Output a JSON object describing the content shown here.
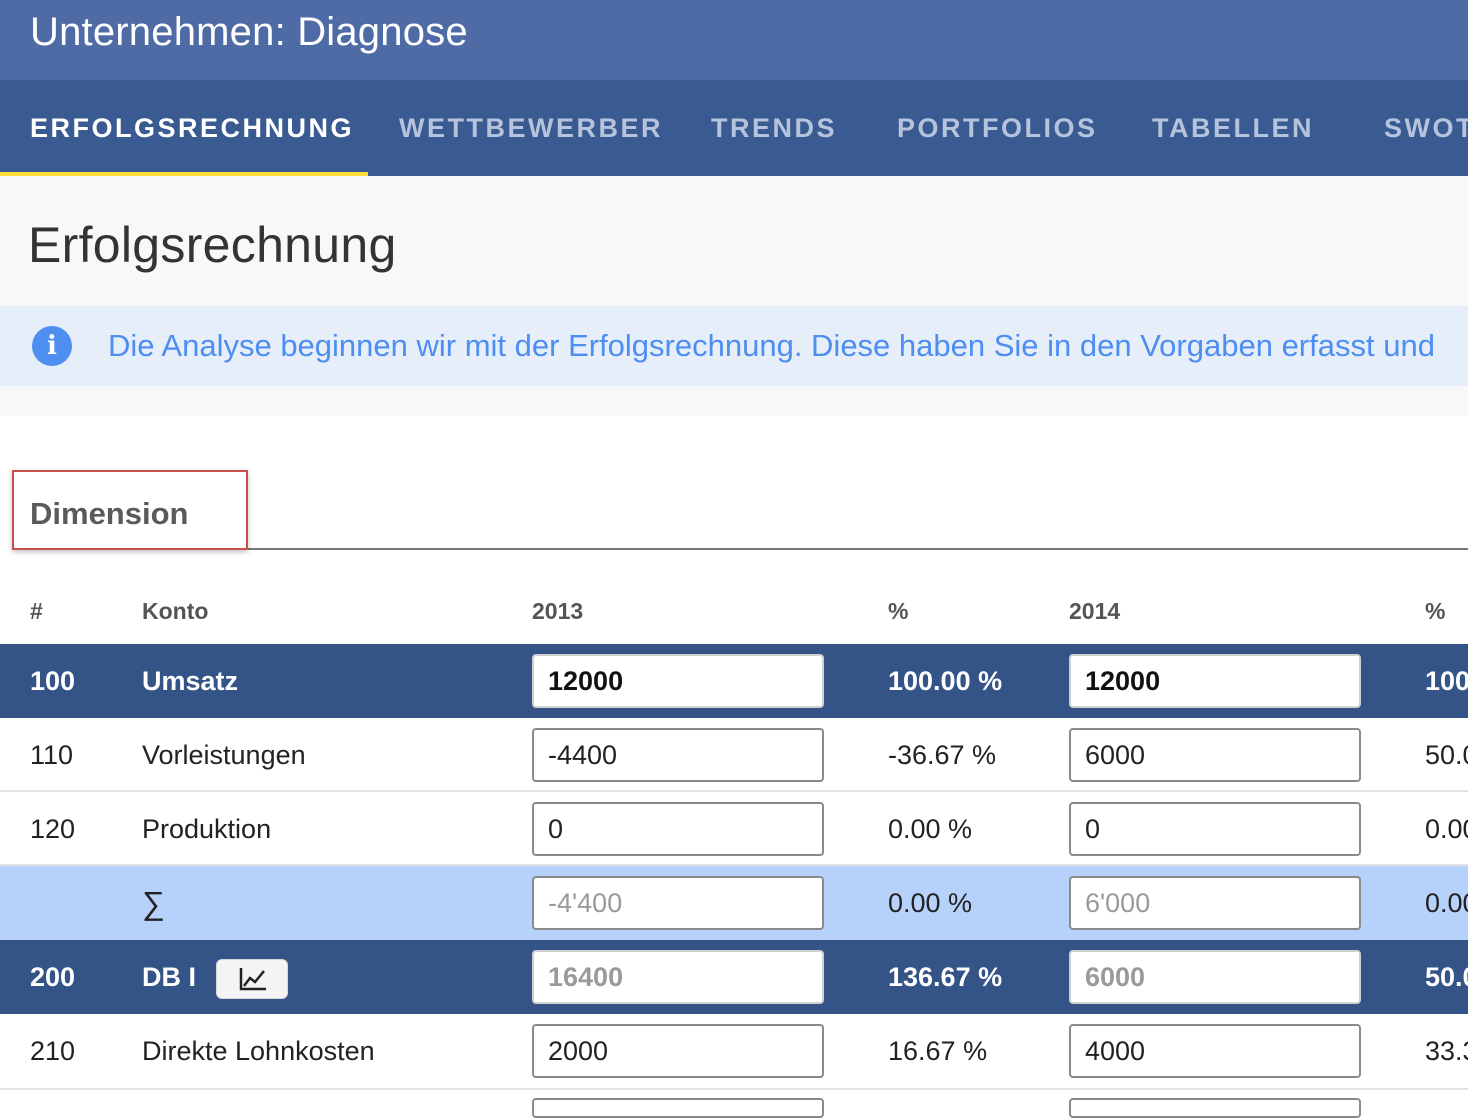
{
  "appbar": {
    "title": "Unternehmen: Diagnose"
  },
  "tabs": [
    {
      "label": "ERFOLGSRECHNUNG",
      "active": true
    },
    {
      "label": "WETTBEWERBER",
      "active": false
    },
    {
      "label": "TRENDS",
      "active": false
    },
    {
      "label": "PORTFOLIOS",
      "active": false
    },
    {
      "label": "TABELLEN",
      "active": false
    },
    {
      "label": "SWOT",
      "active": false
    }
  ],
  "page": {
    "title": "Erfolgsrechnung"
  },
  "banner": {
    "icon": "info-icon",
    "text": "Die Analyse beginnen wir mit der Erfolgsrechnung. Diese haben Sie in den Vorgaben erfasst und"
  },
  "section": {
    "label": "Dimension"
  },
  "table": {
    "headers": {
      "num": "#",
      "konto": "Konto",
      "y2013": "2013",
      "pct2013": "%",
      "y2014": "2014",
      "pct2014": "%"
    },
    "rows": [
      {
        "num": "100",
        "konto": "Umsatz",
        "v2013": "12000",
        "p2013": "100.00 %",
        "v2014": "12000",
        "p2014": "100"
      },
      {
        "num": "110",
        "konto": "Vorleistungen",
        "v2013": "-4400",
        "p2013": "-36.67 %",
        "v2014": "6000",
        "p2014": "50.0"
      },
      {
        "num": "120",
        "konto": "Produktion",
        "v2013": "0",
        "p2013": "0.00 %",
        "v2014": "0",
        "p2014": "0.00"
      },
      {
        "num": "",
        "konto": "∑",
        "v2013": "-4'400",
        "p2013": "0.00 %",
        "v2014": "6'000",
        "p2014": "0.00"
      },
      {
        "num": "200",
        "konto": "DB I",
        "v2013": "16400",
        "p2013": "136.67 %",
        "v2014": "6000",
        "p2014": "50.0"
      },
      {
        "num": "210",
        "konto": "Direkte Lohnkosten",
        "v2013": "2000",
        "p2013": "16.67 %",
        "v2014": "4000",
        "p2014": "33.3"
      }
    ]
  },
  "colors": {
    "appbar": "#4f6ba6",
    "tabbar": "#3a5a92",
    "indicator": "#ffe03a",
    "main_row": "#345386",
    "sum_row": "#b6d1fa",
    "info": "#4d8ef0"
  }
}
